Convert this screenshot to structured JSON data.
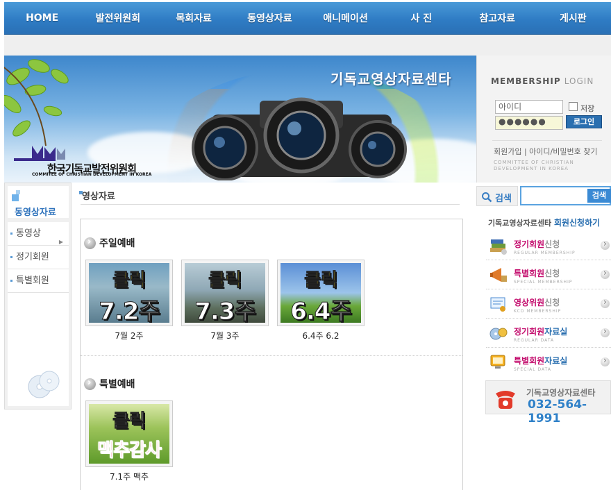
{
  "nav": [
    "HOME",
    "발전위원회",
    "목회자료",
    "동영상자료",
    "애니메이션",
    "사 진",
    "참고자료",
    "게시판"
  ],
  "banner": {
    "title": "기독교영상자료센타",
    "org_name": "한국기독교발전위원회",
    "org_logo": "KCD",
    "org_english": "COMMITEE OF CHRISTIAN DEVELOPMENT IN KOREA"
  },
  "membership": {
    "title": "MEMBERSHIP",
    "login_word": "LOGIN",
    "id_value": "아이디",
    "pw_value": "●●●●●●",
    "save_label": "저장",
    "login_button": "로그인",
    "links": "회원가입 | 아이디/비밀번호 찾기",
    "sub_line1": "COMMITTEE OF CHRISTIAN",
    "sub_line2": "DEVELOPMENT IN KOREA"
  },
  "left": {
    "title": "동영상자료",
    "items": [
      "동영상",
      "정기회원",
      "특별회원"
    ]
  },
  "main": {
    "section_title": "영상자료",
    "categories": [
      {
        "title": "주일예배",
        "items": [
          {
            "line1": "클릭",
            "line2": "7.2주",
            "caption": "7월 2주"
          },
          {
            "line1": "클릭",
            "line2": "7.3주",
            "caption": "7월 3주"
          },
          {
            "line1": "클릭",
            "line2": "6.4주",
            "caption": "6.4주 6.2"
          }
        ]
      },
      {
        "title": "특별예배",
        "items": [
          {
            "line1": "클릭",
            "line2": "맥추감사",
            "caption": "7.1주 맥추"
          }
        ]
      }
    ]
  },
  "right": {
    "search_label": "검색",
    "search_button": "검색",
    "header_name": "기독교영상자료센타",
    "header_apply": "회원신청하기",
    "rows": [
      {
        "label_a": "정기회원",
        "label_b": "신청",
        "sub": "REGULAR MEMBERSHIP",
        "icon": "books-icon",
        "color_a": "#c4106f",
        "color_b": "#999999"
      },
      {
        "label_a": "특별회원",
        "label_b": "신청",
        "sub": "SPECIAL MEMBERSHIP",
        "icon": "megaphone-icon",
        "color_a": "#c4106f",
        "color_b": "#999999"
      },
      {
        "label_a": "영상위원",
        "label_b": "신청",
        "sub": "KCD MEMBERSHIP",
        "icon": "certificate-icon",
        "color_a": "#c4106f",
        "color_b": "#999999"
      },
      {
        "label_a": "정기회원",
        "label_b": "자료실",
        "sub": "REGULAR DATA",
        "icon": "cd-icon",
        "color_a": "#c4106f",
        "color_b": "#2a6fb0"
      },
      {
        "label_a": "특별회원",
        "label_b": "자료실",
        "sub": "SPECIAL DATA",
        "icon": "monitor-icon",
        "color_a": "#c4106f",
        "color_b": "#2a6fb0"
      }
    ],
    "contact_name": "기독교영상자료센타",
    "contact_phone": "032-564-1991"
  },
  "colors": {
    "nav_blue": "#2f7cc4",
    "accent_blue": "#2e80c8",
    "magenta": "#c4106f"
  }
}
